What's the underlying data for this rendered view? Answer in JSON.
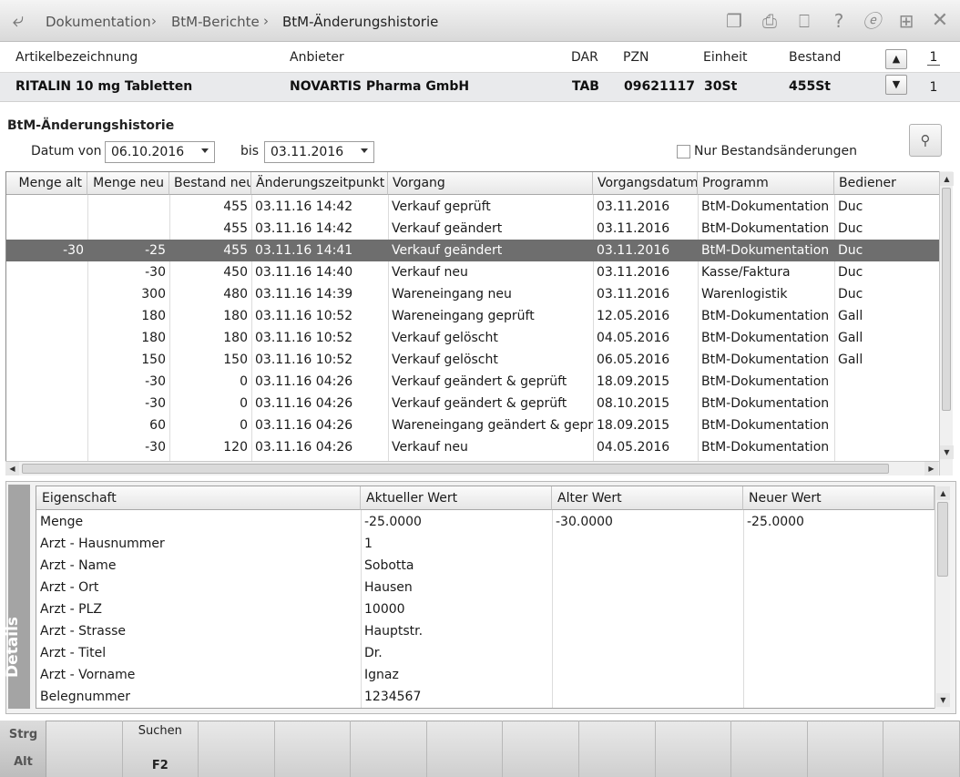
{
  "breadcrumb": {
    "items": [
      "Dokumentation",
      "BtM-Berichte",
      "BtM-Änderungshistorie"
    ]
  },
  "toolbar_icons": [
    "copy-icon",
    "print-icon",
    "monitor-icon",
    "help-icon",
    "e-icon",
    "export-icon",
    "close-icon"
  ],
  "article": {
    "headers": {
      "name": "Artikelbezeichnung",
      "supplier": "Anbieter",
      "dar": "DAR",
      "pzn": "PZN",
      "unit": "Einheit",
      "stock": "Bestand"
    },
    "values": {
      "name": "RITALIN 10 mg Tabletten",
      "supplier": "NOVARTIS Pharma GmbH",
      "dar": "TAB",
      "pzn": "09621117",
      "unit": "30St",
      "stock": "455St"
    },
    "pager_top": "1",
    "pager_bottom": "1"
  },
  "section": {
    "title": "BtM-Änderungshistorie"
  },
  "filter": {
    "from_label": "Datum von",
    "from_value": "06.10.2016",
    "to_label": "bis",
    "to_value": "03.11.2016",
    "only_stock_changes_label": "Nur Bestandsänderungen",
    "only_stock_changes_checked": false
  },
  "history": {
    "columns": [
      "Menge alt",
      "Menge neu",
      "Bestand neu",
      "Änderungszeitpunkt",
      "Vorgang",
      "Vorgangsdatum",
      "Programm",
      "Bediener"
    ],
    "selected_index": 2,
    "rows": [
      [
        "",
        "",
        "455",
        "03.11.16 14:42",
        "Verkauf geprüft",
        "03.11.2016",
        "BtM-Dokumentation",
        "Duc"
      ],
      [
        "",
        "",
        "455",
        "03.11.16 14:42",
        "Verkauf geändert",
        "03.11.2016",
        "BtM-Dokumentation",
        "Duc"
      ],
      [
        "-30",
        "-25",
        "455",
        "03.11.16 14:41",
        "Verkauf geändert",
        "03.11.2016",
        "BtM-Dokumentation",
        "Duc"
      ],
      [
        "",
        "-30",
        "450",
        "03.11.16 14:40",
        "Verkauf neu",
        "03.11.2016",
        "Kasse/Faktura",
        "Duc"
      ],
      [
        "",
        "300",
        "480",
        "03.11.16 14:39",
        "Wareneingang neu",
        "03.11.2016",
        "Warenlogistik",
        "Duc"
      ],
      [
        "",
        "180",
        "180",
        "03.11.16 10:52",
        "Wareneingang geprüft",
        "12.05.2016",
        "BtM-Dokumentation",
        "Gall"
      ],
      [
        "",
        "180",
        "180",
        "03.11.16 10:52",
        "Verkauf gelöscht",
        "04.05.2016",
        "BtM-Dokumentation",
        "Gall"
      ],
      [
        "",
        "150",
        "150",
        "03.11.16 10:52",
        "Verkauf gelöscht",
        "06.05.2016",
        "BtM-Dokumentation",
        "Gall"
      ],
      [
        "",
        "-30",
        "0",
        "03.11.16 04:26",
        "Verkauf geändert & geprüft",
        "18.09.2015",
        "BtM-Dokumentation",
        ""
      ],
      [
        "",
        "-30",
        "0",
        "03.11.16 04:26",
        "Verkauf geändert & geprüft",
        "08.10.2015",
        "BtM-Dokumentation",
        ""
      ],
      [
        "",
        "60",
        "0",
        "03.11.16 04:26",
        "Wareneingang geändert & geprü",
        "18.09.2015",
        "BtM-Dokumentation",
        ""
      ],
      [
        "",
        "-30",
        "120",
        "03.11.16 04:26",
        "Verkauf neu",
        "04.05.2016",
        "BtM-Dokumentation",
        ""
      ]
    ]
  },
  "details": {
    "side_label": "Details",
    "columns": [
      "Eigenschaft",
      "Aktueller Wert",
      "Alter Wert",
      "Neuer Wert"
    ],
    "rows": [
      [
        "Menge",
        "-25.0000",
        "-30.0000",
        "-25.0000"
      ],
      [
        "Arzt - Hausnummer",
        "1",
        "",
        ""
      ],
      [
        "Arzt - Name",
        "Sobotta",
        "",
        ""
      ],
      [
        "Arzt - Ort",
        "Hausen",
        "",
        ""
      ],
      [
        "Arzt - PLZ",
        "10000",
        "",
        ""
      ],
      [
        "Arzt - Strasse",
        "Hauptstr.",
        "",
        ""
      ],
      [
        "Arzt - Titel",
        "Dr.",
        "",
        ""
      ],
      [
        "Arzt - Vorname",
        "Ignaz",
        "",
        ""
      ],
      [
        "Belegnummer",
        "1234567",
        "",
        ""
      ]
    ]
  },
  "function_keys": {
    "modifiers": [
      "Strg",
      "Alt"
    ],
    "keys": [
      {
        "label": "",
        "key": ""
      },
      {
        "label": "Suchen",
        "key": "F2"
      },
      {
        "label": "",
        "key": ""
      },
      {
        "label": "",
        "key": ""
      },
      {
        "label": "",
        "key": ""
      },
      {
        "label": "",
        "key": ""
      },
      {
        "label": "",
        "key": ""
      },
      {
        "label": "",
        "key": ""
      },
      {
        "label": "",
        "key": ""
      },
      {
        "label": "",
        "key": ""
      },
      {
        "label": "",
        "key": ""
      },
      {
        "label": "",
        "key": ""
      }
    ]
  }
}
